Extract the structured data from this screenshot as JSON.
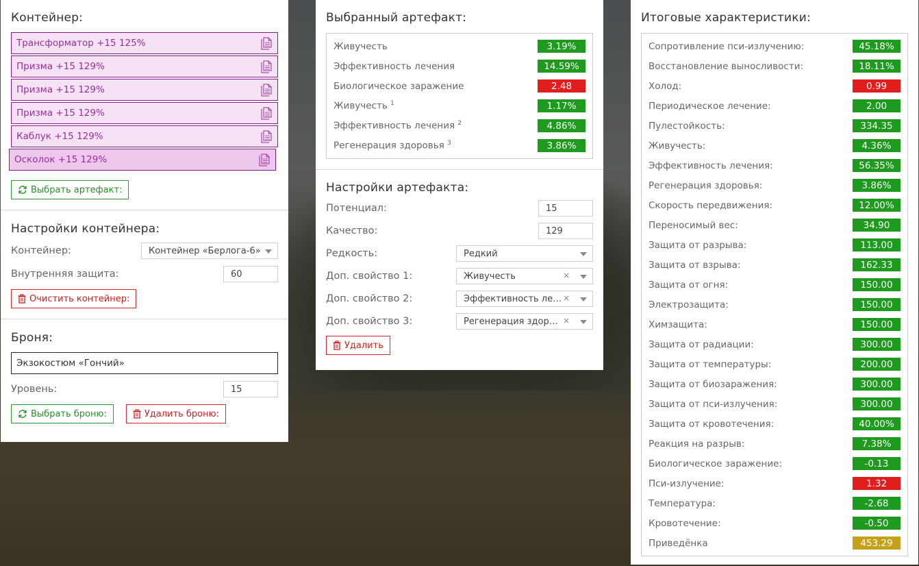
{
  "colors": {
    "positive": "#1e9a1e",
    "negative": "#e01e1e",
    "neutral": "#c6a018",
    "accent": "#8b1a8b"
  },
  "left": {
    "container": {
      "title": "Контейнер:",
      "items": [
        {
          "label": "Трансформатор +15 125%",
          "icon": "document-copy-icon"
        },
        {
          "label": "Призма +15 129%",
          "icon": "document-copy-icon"
        },
        {
          "label": "Призма +15 129%",
          "icon": "document-copy-icon"
        },
        {
          "label": "Призма +15 129%",
          "icon": "document-copy-icon"
        },
        {
          "label": "Каблук +15 129%",
          "icon": "document-copy-icon"
        },
        {
          "label": "Осколок +15 129%",
          "icon": "document-copy-icon",
          "selected": true
        }
      ],
      "choose_button": "Выбрать артефакт:"
    },
    "container_settings": {
      "title": "Настройки контейнера:",
      "container_label": "Контейнер:",
      "container_value": "Контейнер «Берлога-6»",
      "protection_label": "Внутренняя защита:",
      "protection_value": "60",
      "clear_button": "Очистить контейнер:"
    },
    "armor": {
      "title": "Броня:",
      "name_value": "Экзокостюм «Гончий»",
      "level_label": "Уровень:",
      "level_value": "15",
      "choose_button": "Выбрать броню:",
      "delete_button": "Удалить броню:"
    }
  },
  "middle": {
    "selected": {
      "title": "Выбранный артефакт:",
      "stats": [
        {
          "label": "Живучесть",
          "sup": "",
          "value": "3.19%",
          "color": "green"
        },
        {
          "label": "Эффективность лечения",
          "sup": "",
          "value": "14.59%",
          "color": "green"
        },
        {
          "label": "Биологическое заражение",
          "sup": "",
          "value": "2.48",
          "color": "red"
        },
        {
          "label": "Живучесть",
          "sup": "1",
          "value": "1.17%",
          "color": "green"
        },
        {
          "label": "Эффективность лечения",
          "sup": "2",
          "value": "4.86%",
          "color": "green"
        },
        {
          "label": "Регенерация здоровья",
          "sup": "3",
          "value": "3.86%",
          "color": "green"
        }
      ]
    },
    "settings": {
      "title": "Настройки артефакта:",
      "potential_label": "Потенциал:",
      "potential_value": "15",
      "quality_label": "Качество:",
      "quality_value": "129",
      "rarity_label": "Редкость:",
      "rarity_value": "Редкий",
      "prop1_label": "Доп. свойство 1:",
      "prop1_value": "Живучесть",
      "prop2_label": "Доп. свойство 2:",
      "prop2_value": "Эффективность лечения",
      "prop3_label": "Доп. свойство 3:",
      "prop3_value": "Регенерация здоровья",
      "delete_button": "Удалить"
    }
  },
  "right": {
    "title": "Итоговые характеристики:",
    "stats": [
      {
        "label": "Сопротивление пси-излучению:",
        "value": "45.18%",
        "color": "green"
      },
      {
        "label": "Восстановление выносливости:",
        "value": "18.11%",
        "color": "green"
      },
      {
        "label": "Холод:",
        "value": "0.99",
        "color": "red"
      },
      {
        "label": "Периодическое лечение:",
        "value": "2.00",
        "color": "green"
      },
      {
        "label": "Пулестойкость:",
        "value": "334.35",
        "color": "green"
      },
      {
        "label": "Живучесть:",
        "value": "4.36%",
        "color": "green"
      },
      {
        "label": "Эффективность лечения:",
        "value": "56.35%",
        "color": "green"
      },
      {
        "label": "Регенерация здоровья:",
        "value": "3.86%",
        "color": "green"
      },
      {
        "label": "Скорость передвижения:",
        "value": "12.00%",
        "color": "green"
      },
      {
        "label": "Переносимый вес:",
        "value": "34.90",
        "color": "green"
      },
      {
        "label": "Защита от разрыва:",
        "value": "113.00",
        "color": "green"
      },
      {
        "label": "Защита от взрыва:",
        "value": "162.33",
        "color": "green"
      },
      {
        "label": "Защита от огня:",
        "value": "150.00",
        "color": "green"
      },
      {
        "label": "Электрозащита:",
        "value": "150.00",
        "color": "green"
      },
      {
        "label": "Химзащита:",
        "value": "150.00",
        "color": "green"
      },
      {
        "label": "Защита от радиации:",
        "value": "300.00",
        "color": "green"
      },
      {
        "label": "Защита от температуры:",
        "value": "200.00",
        "color": "green"
      },
      {
        "label": "Защита от биозаражения:",
        "value": "300.00",
        "color": "green"
      },
      {
        "label": "Защита от пси-излучения:",
        "value": "300.00",
        "color": "green"
      },
      {
        "label": "Защита от кровотечения:",
        "value": "40.00%",
        "color": "green"
      },
      {
        "label": "Реакция на разрыв:",
        "value": "7.38%",
        "color": "green"
      },
      {
        "label": "Биологическое заражение:",
        "value": "-0.13",
        "color": "green"
      },
      {
        "label": "Пси-излучение:",
        "value": "1.32",
        "color": "red"
      },
      {
        "label": "Температура:",
        "value": "-2.68",
        "color": "green"
      },
      {
        "label": "Кровотечение:",
        "value": "-0.50",
        "color": "green"
      },
      {
        "label": "Приведёнка",
        "value": "453.29",
        "color": "gold"
      }
    ]
  }
}
